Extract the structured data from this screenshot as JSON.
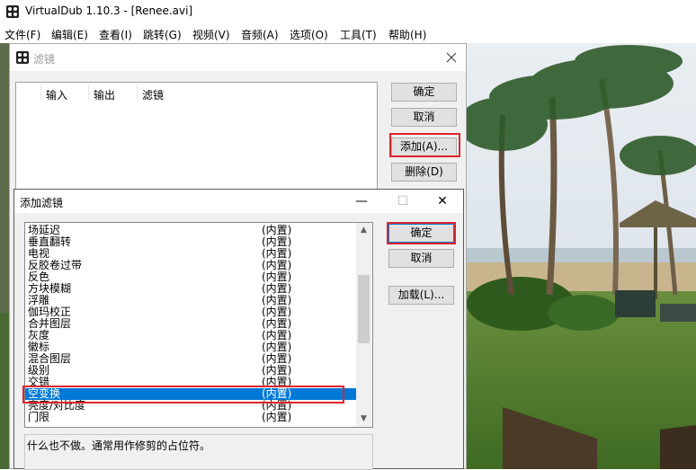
{
  "app": {
    "title": "VirtualDub 1.10.3 - [Renee.avi]"
  },
  "menu": [
    "文件(F)",
    "编辑(E)",
    "查看(I)",
    "跳转(G)",
    "视频(V)",
    "音频(A)",
    "选项(O)",
    "工具(T)",
    "帮助(H)"
  ],
  "filters_dialog": {
    "title": "滤镜",
    "columns": [
      "输入",
      "输出",
      "滤镜"
    ],
    "buttons": {
      "ok": "确定",
      "cancel": "取消",
      "add": "添加(A)...",
      "delete": "删除(D)"
    }
  },
  "add_filter_dialog": {
    "title": "添加滤镜",
    "buttons": {
      "ok": "确定",
      "cancel": "取消",
      "load": "加载(L)..."
    },
    "filters": [
      {
        "name": "场延迟",
        "source": "(内置)"
      },
      {
        "name": "垂直翻转",
        "source": "(内置)"
      },
      {
        "name": "电视",
        "source": "(内置)"
      },
      {
        "name": "反胶卷过带",
        "source": "(内置)"
      },
      {
        "name": "反色",
        "source": "(内置)"
      },
      {
        "name": "方块模糊",
        "source": "(内置)"
      },
      {
        "name": "浮雕",
        "source": "(内置)"
      },
      {
        "name": "伽玛校正",
        "source": "(内置)"
      },
      {
        "name": "合并图层",
        "source": "(内置)"
      },
      {
        "name": "灰度",
        "source": "(内置)"
      },
      {
        "name": "徽标",
        "source": "(内置)"
      },
      {
        "name": "混合图层",
        "source": "(内置)"
      },
      {
        "name": "级别",
        "source": "(内置)"
      },
      {
        "name": "交错",
        "source": "(内置)"
      },
      {
        "name": "空变换",
        "source": "(内置)",
        "selected": true
      },
      {
        "name": "亮度/对比度",
        "source": "(内置)"
      },
      {
        "name": "门限",
        "source": "(内置)"
      }
    ],
    "description": "什么也不做。通常用作修剪的占位符。"
  },
  "colors": {
    "selection": "#0078d7",
    "highlight": "#e0242b",
    "dialog_bg": "#f0f0f0"
  }
}
